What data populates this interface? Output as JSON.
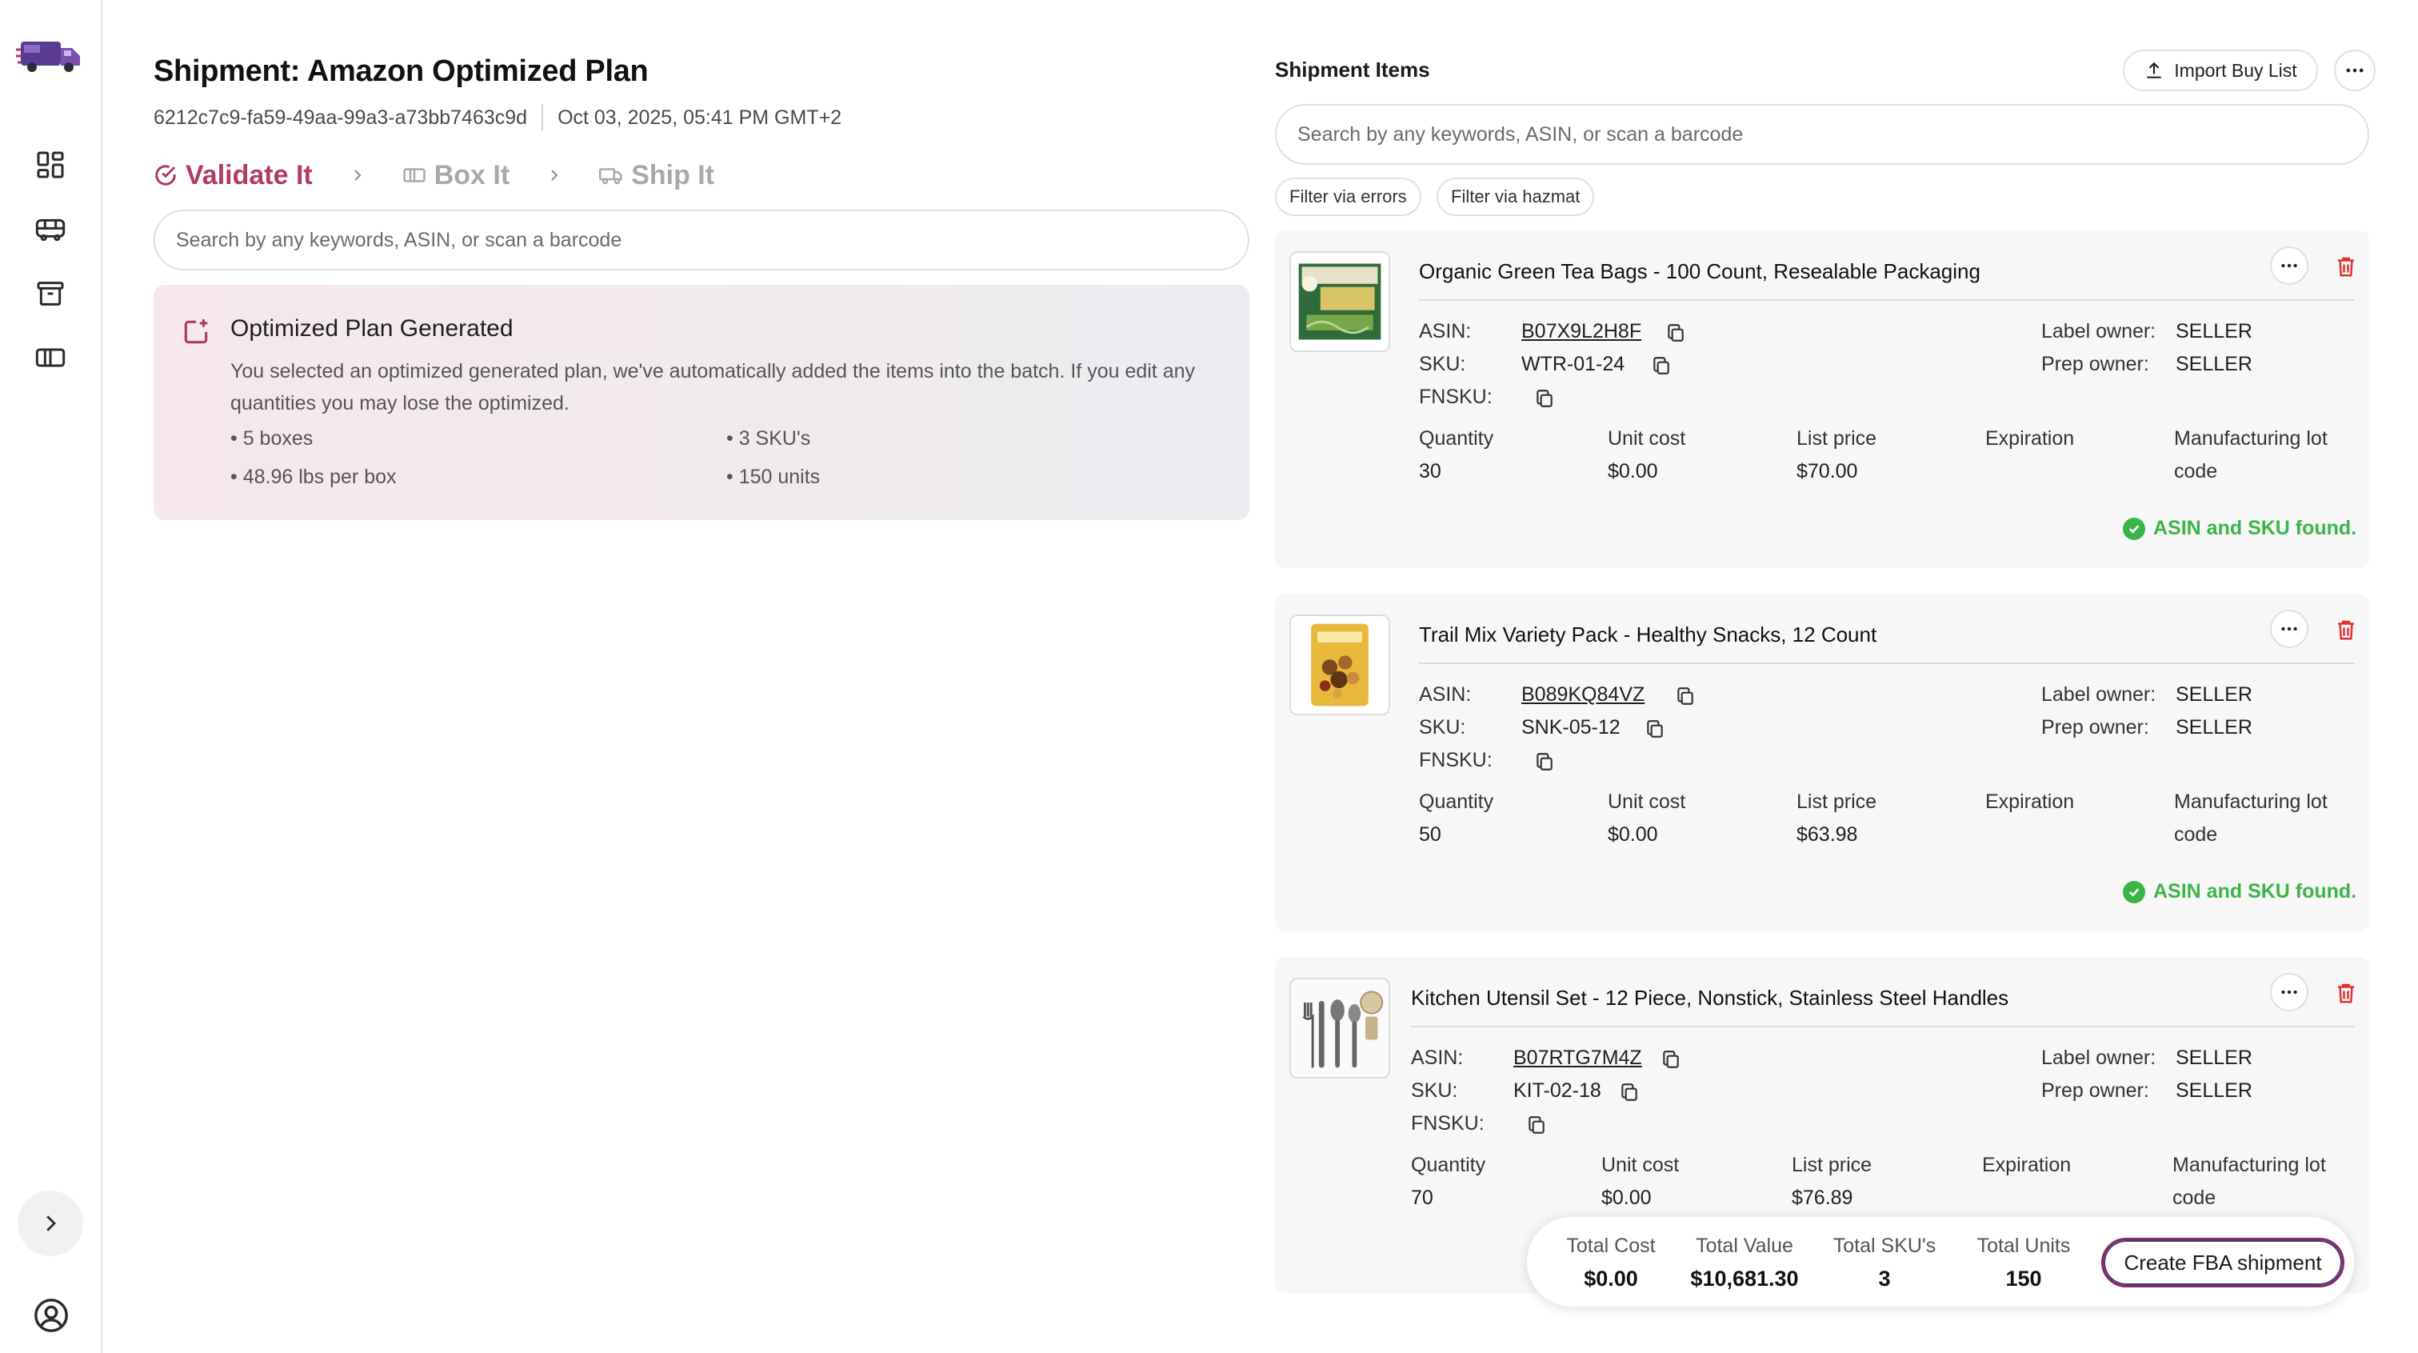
{
  "sidebar": {
    "logo": "truck-logo",
    "items": [
      {
        "icon": "dashboard-icon"
      },
      {
        "icon": "bus-icon"
      },
      {
        "icon": "archive-icon"
      },
      {
        "icon": "box-icon"
      }
    ],
    "expand_icon": "chevron-right-icon",
    "user_icon": "user-circle-icon"
  },
  "header": {
    "title": "Shipment: Amazon Optimized Plan",
    "shipment_id": "6212c7c9-fa59-49aa-99a3-a73bb7463c9d",
    "date": "Oct 03, 2025, 05:41 PM GMT+2"
  },
  "steps": [
    {
      "label": "Validate It",
      "icon": "check-circle-icon",
      "active": true
    },
    {
      "label": "Box It",
      "icon": "box-icon",
      "active": false
    },
    {
      "label": "Ship It",
      "icon": "truck-icon",
      "active": false
    }
  ],
  "left_search": {
    "placeholder": "Search by any keywords, ASIN, or scan a barcode"
  },
  "plan": {
    "title": "Optimized Plan Generated",
    "description": "You selected an optimized generated plan, we've automatically added the items into the batch. If you edit any quantities you may lose the optimized.",
    "bullets": [
      "• 5 boxes",
      "• 3 SKU's",
      "• 48.96 lbs per box",
      "• 150 units"
    ]
  },
  "items_panel": {
    "title": "Shipment Items",
    "import_label": "Import Buy List",
    "search_placeholder": "Search by any keywords, ASIN, or scan a barcode",
    "filters": [
      "Filter via errors",
      "Filter via hazmat"
    ],
    "labels": {
      "asin": "ASIN:",
      "sku": "SKU:",
      "fnsku": "FNSKU:",
      "label_owner": "Label owner:",
      "prep_owner": "Prep owner:",
      "quantity": "Quantity",
      "unit_cost": "Unit cost",
      "list_price": "List price",
      "expiration": "Expiration",
      "mfg_lot_1": "Manufacturing lot",
      "mfg_lot_2": "code"
    },
    "items": [
      {
        "name": "Organic Green Tea Bags - 100 Count, Resealable Packaging",
        "asin": "B07X9L2H8F",
        "sku": "WTR-01-24",
        "fnsku": "",
        "label_owner": "SELLER",
        "prep_owner": "SELLER",
        "quantity": "30",
        "unit_cost": "$0.00",
        "list_price": "$70.00",
        "expiration": "",
        "status": "ASIN and SKU found."
      },
      {
        "name": "Trail Mix Variety Pack - Healthy Snacks, 12 Count",
        "asin": "B089KQ84VZ",
        "sku": "SNK-05-12",
        "fnsku": "",
        "label_owner": "SELLER",
        "prep_owner": "SELLER",
        "quantity": "50",
        "unit_cost": "$0.00",
        "list_price": "$63.98",
        "expiration": "",
        "status": "ASIN and SKU found."
      },
      {
        "name": "Kitchen Utensil Set - 12 Piece, Nonstick, Stainless Steel Handles",
        "asin": "B07RTG7M4Z",
        "sku": "KIT-02-18",
        "fnsku": "",
        "label_owner": "SELLER",
        "prep_owner": "SELLER",
        "quantity": "70",
        "unit_cost": "$0.00",
        "list_price": "$76.89",
        "expiration": ""
      }
    ]
  },
  "totals": {
    "cost_label": "Total Cost",
    "cost": "$0.00",
    "value_label": "Total Value",
    "value": "$10,681.30",
    "skus_label": "Total SKU's",
    "skus": "3",
    "units_label": "Total Units",
    "units": "150",
    "create_label": "Create FBA shipment"
  },
  "colors": {
    "accent": "#b23a63",
    "success": "#3bb54a",
    "danger": "#e0322f",
    "muted": "#a8a8a8"
  }
}
